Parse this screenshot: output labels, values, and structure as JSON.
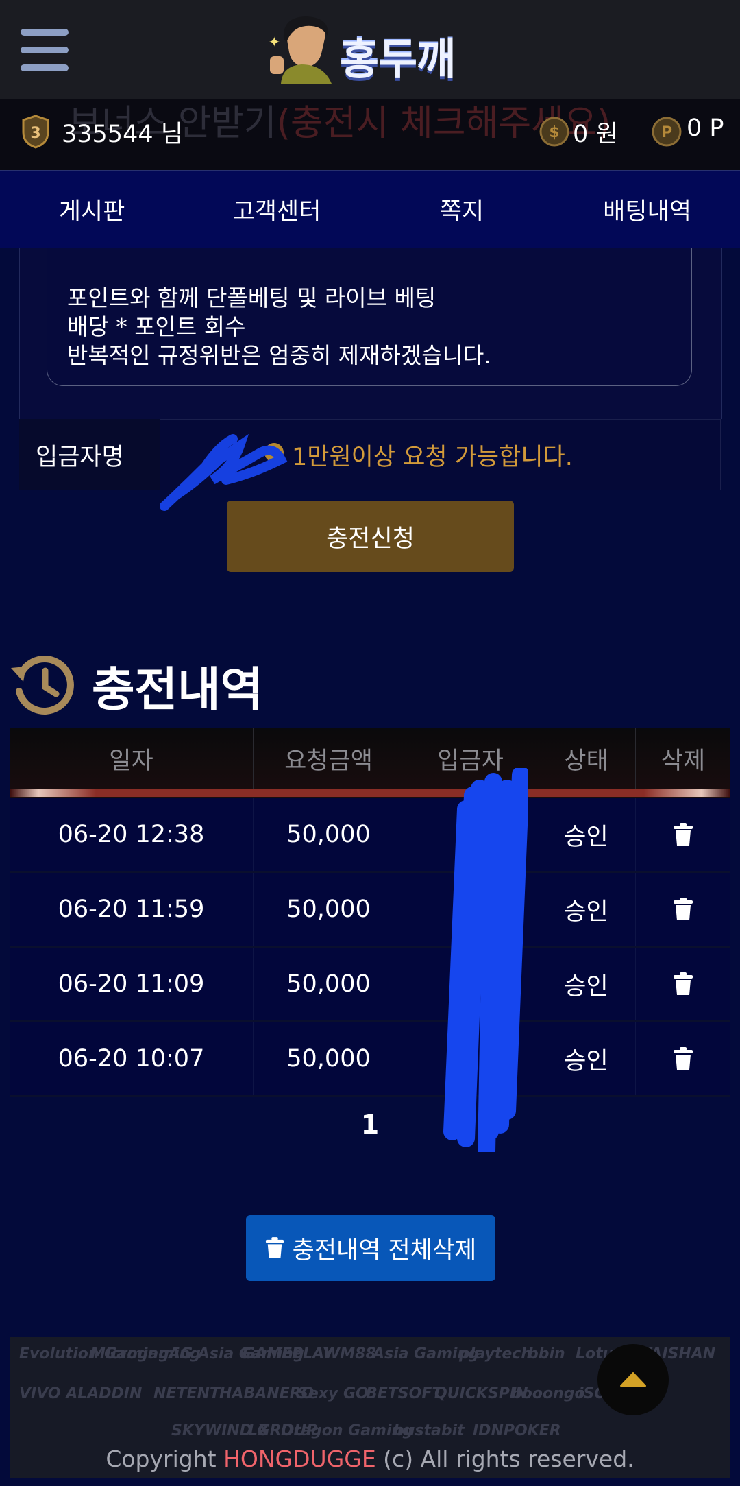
{
  "header": {
    "logo_text": "홍두깨",
    "menu_icon": "hamburger-menu-icon"
  },
  "userbar": {
    "background_text": "보너스 안받기",
    "background_text_red": "(충전시 체크해주세요)",
    "level": "3",
    "username": "335544 님",
    "money": "0 원",
    "points": "0 P"
  },
  "nav": {
    "items": [
      {
        "label": "게시판"
      },
      {
        "label": "고객센터"
      },
      {
        "label": "쪽지"
      },
      {
        "label": "배팅내역"
      }
    ]
  },
  "notice": {
    "lines": [
      "포인트와 함께 단폴베팅 및 라이브 베팅",
      "배당 * 포인트 회수",
      "반복적인 규정위반은 엄중히 제재하겠습니다."
    ]
  },
  "deposit": {
    "label": "입금자명",
    "hint": "1만원이상 요청 가능합니다.",
    "button": "충전신청"
  },
  "history": {
    "title": "충전내역",
    "columns": [
      "일자",
      "요청금액",
      "입금자",
      "상태",
      "삭제"
    ],
    "rows": [
      {
        "date": "06-20 12:38",
        "amount": "50,000",
        "depositor": "",
        "status": "승인"
      },
      {
        "date": "06-20 11:59",
        "amount": "50,000",
        "depositor": "",
        "status": "승인"
      },
      {
        "date": "06-20 11:09",
        "amount": "50,000",
        "depositor": "",
        "status": "승인"
      },
      {
        "date": "06-20 10:07",
        "amount": "50,000",
        "depositor": "",
        "status": "승인"
      }
    ],
    "page": "1",
    "delete_all": "충전내역 전체삭제"
  },
  "footer": {
    "providers": [
      "Evolution Gaming",
      "Microgaming",
      "AG Asia Gaming",
      "GAMEPLAY",
      "WM88",
      "Asia Gaming",
      "playtech",
      "bbin",
      "Lotus",
      "TAISHAN",
      "VIVO ALADDIN",
      "HABANERO",
      "NETENT",
      "Habanero",
      "Sexy GO",
      "BETSOFT",
      "QUICKSPIN",
      "booongo",
      "iSOFTBET",
      "pragmatic",
      "SKYWIND GROUP",
      "LX",
      "Dragon Gaming",
      "bustabit",
      "IDNPOKER"
    ],
    "copyright_prefix": "Copyright ",
    "copyright_brand": "HONGDUGGE",
    "copyright_suffix": " (c) All rights reserved."
  },
  "colors": {
    "page_bg": "#030a3a",
    "nav_bg": "#020857",
    "gold_button": "#664b1c",
    "hint_orange": "#d29a3a",
    "blue_button": "#0857b8",
    "brand_red": "#f0646b"
  }
}
